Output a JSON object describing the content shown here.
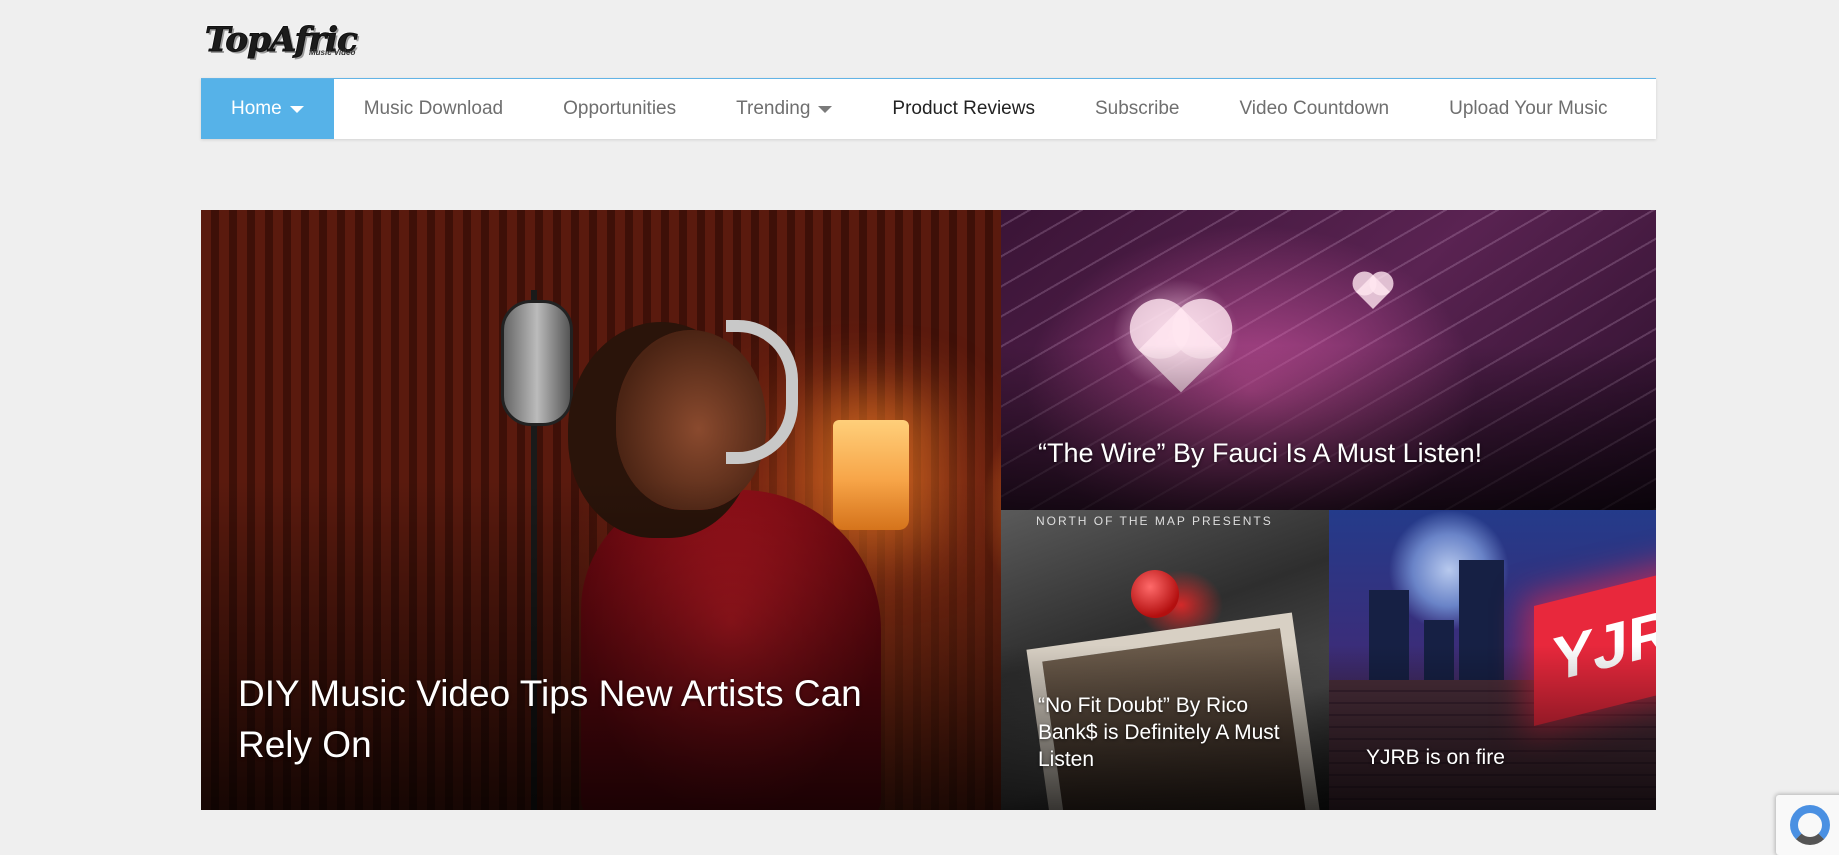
{
  "site": {
    "logo_text": "TopAfric",
    "logo_subtext": "Music Video"
  },
  "nav": {
    "items": [
      {
        "label": "Home",
        "has_dropdown": true,
        "active": true
      },
      {
        "label": "Music Download",
        "has_dropdown": false
      },
      {
        "label": "Opportunities",
        "has_dropdown": false
      },
      {
        "label": "Trending",
        "has_dropdown": true
      },
      {
        "label": "Product Reviews",
        "has_dropdown": false
      },
      {
        "label": "Subscribe",
        "has_dropdown": false
      },
      {
        "label": "Video Countdown",
        "has_dropdown": false
      },
      {
        "label": "Upload Your Music",
        "has_dropdown": false
      }
    ],
    "active_color": "#56b2e8"
  },
  "featured": {
    "main": {
      "title": "DIY Music Video Tips New Artists Can Rely On"
    },
    "top_right": {
      "title": "“The Wire” By Fauci Is A Must Listen!"
    },
    "bottom_mid": {
      "title": "“No Fit Doubt” By Rico Bank$ is Definitely A Must Listen",
      "artwork_text": "NORTH OF THE MAP PRESENTS"
    },
    "bottom_right": {
      "title": "YJRB is on fire",
      "artwork_text": "YJRI"
    }
  }
}
